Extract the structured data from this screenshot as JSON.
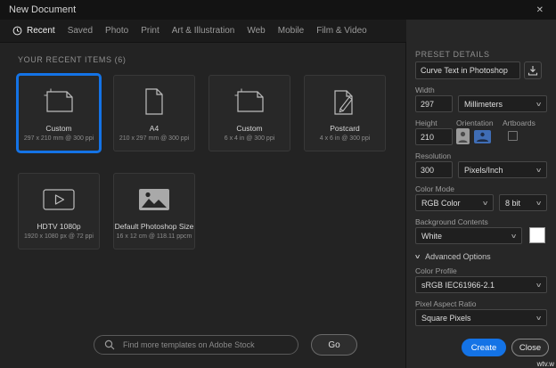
{
  "window": {
    "title": "New Document"
  },
  "icons": {
    "close": "✕",
    "chevron_down": "∨"
  },
  "colors": {
    "accent": "#1473e6"
  },
  "tabs": [
    {
      "label": "Recent"
    },
    {
      "label": "Saved"
    },
    {
      "label": "Photo"
    },
    {
      "label": "Print"
    },
    {
      "label": "Art & Illustration"
    },
    {
      "label": "Web"
    },
    {
      "label": "Mobile"
    },
    {
      "label": "Film & Video"
    }
  ],
  "recent": {
    "heading": "YOUR RECENT ITEMS (6)",
    "items": [
      {
        "name": "Custom",
        "size": "297 x 210 mm @ 300 ppi"
      },
      {
        "name": "A4",
        "size": "210 x 297 mm @ 300 ppi"
      },
      {
        "name": "Custom",
        "size": "6 x 4 in @ 300 ppi"
      },
      {
        "name": "Postcard",
        "size": "4 x 6 in @ 300 ppi"
      },
      {
        "name": "HDTV 1080p",
        "size": "1920 x 1080 px @ 72 ppi"
      },
      {
        "name": "Default Photoshop Size",
        "size": "16 x 12 cm @ 118.11 ppcm"
      }
    ]
  },
  "search": {
    "placeholder": "Find more templates on Adobe Stock",
    "go_label": "Go"
  },
  "preset": {
    "heading": "PRESET DETAILS",
    "document_title": "Curve Text in Photoshop",
    "width": {
      "label": "Width",
      "value": "297",
      "unit": "Millimeters"
    },
    "height": {
      "label": "Height",
      "value": "210"
    },
    "orientation_label": "Orientation",
    "artboards_label": "Artboards",
    "resolution": {
      "label": "Resolution",
      "value": "300",
      "unit": "Pixels/Inch"
    },
    "color_mode": {
      "label": "Color Mode",
      "value": "RGB Color",
      "bit_depth": "8 bit"
    },
    "background": {
      "label": "Background Contents",
      "value": "White"
    },
    "advanced_label": "Advanced Options",
    "color_profile": {
      "label": "Color Profile",
      "value": "sRGB IEC61966-2.1"
    },
    "pixel_aspect_ratio": {
      "label": "Pixel Aspect Ratio",
      "value": "Square Pixels"
    },
    "create_label": "Create",
    "close_label": "Close"
  },
  "watermark": "wtv.w"
}
